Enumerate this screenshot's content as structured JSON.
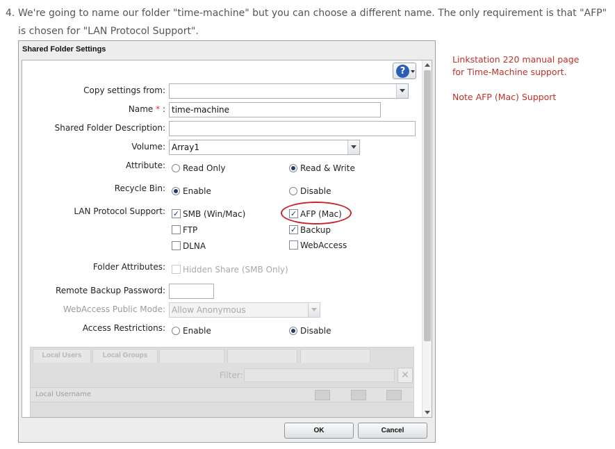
{
  "instruction": {
    "number": "4.",
    "text": "We're going to name our folder \"time-machine\" but you can choose a different name. The only requirement is that \"AFP\" is chosen for \"LAN Protocol Support\"."
  },
  "dialog": {
    "title": "Shared Folder Settings",
    "help_icon": "question-mark-help-icon",
    "fields": {
      "copy_settings_label": "Copy settings from:",
      "copy_settings_value": "",
      "name_label": "Name",
      "name_required_marker": "*",
      "name_colon": ":",
      "name_value": "time-machine",
      "description_label": "Shared Folder Description:",
      "description_value": "",
      "volume_label": "Volume:",
      "volume_value": "Array1",
      "attribute_label": "Attribute:",
      "attribute_read_only": "Read Only",
      "attribute_read_write": "Read & Write",
      "recycle_label": "Recycle Bin:",
      "recycle_enable": "Enable",
      "recycle_disable": "Disable",
      "lan_label": "LAN Protocol Support:",
      "lan_smb": "SMB (Win/Mac)",
      "lan_afp": "AFP (Mac)",
      "lan_ftp": "FTP",
      "lan_backup": "Backup",
      "lan_dlna": "DLNA",
      "lan_webaccess": "WebAccess",
      "folder_attr_label": "Folder Attributes:",
      "folder_attr_hidden": "Hidden Share (SMB Only)",
      "remote_backup_label": "Remote Backup Password:",
      "remote_backup_value": "",
      "webaccess_mode_label": "WebAccess Public Mode:",
      "webaccess_mode_value": "Allow Anonymous",
      "access_label": "Access Restrictions:",
      "access_enable": "Enable",
      "access_disable": "Disable"
    },
    "state": {
      "attribute": "Read & Write",
      "recycle_bin": "Enable",
      "access_restrictions": "Disable",
      "smb_checked": true,
      "afp_checked": true,
      "ftp_checked": false,
      "backup_checked": true,
      "dlna_checked": false,
      "webaccess_checked": false,
      "hidden_share_checked": false
    },
    "grid": {
      "tabs": [
        "Local Users",
        "Local Groups",
        "",
        "",
        ""
      ],
      "filter_label": "Filter:",
      "filter_clear_icon": "close-x-icon",
      "column_username": "Local Username",
      "permission_icons": [
        "write-read-icon",
        "read-icon",
        "no-access-icon"
      ]
    },
    "buttons": {
      "ok": "OK",
      "cancel": "Cancel"
    },
    "annotation_color": "#c9252c"
  },
  "side_note": {
    "line1": "Linkstation 220 manual page for Time-Machine support.",
    "line2": "Note AFP (Mac) Support",
    "color": "#c0302a"
  }
}
